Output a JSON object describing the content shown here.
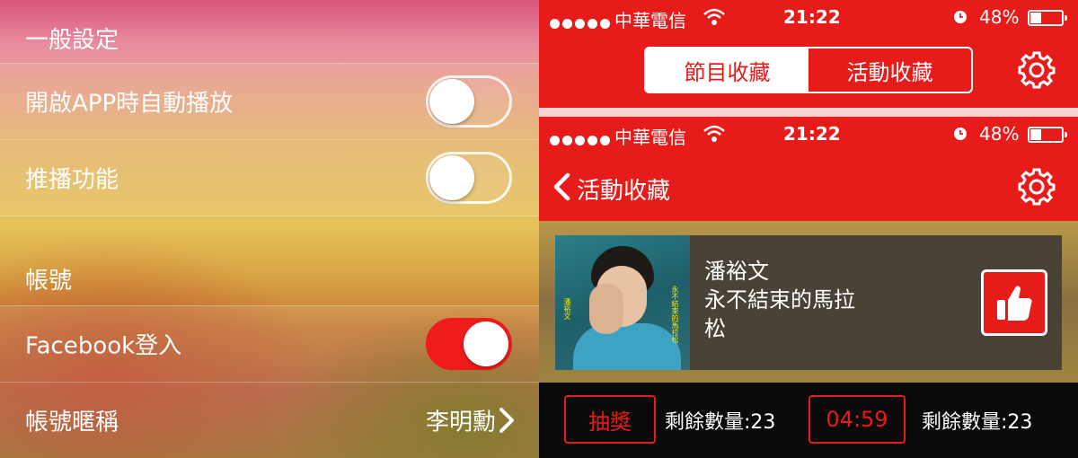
{
  "settings": {
    "general_header": "一般設定",
    "autoplay": {
      "label": "開啟APP時自動播放",
      "on": false
    },
    "push": {
      "label": "推播功能",
      "on": false
    },
    "account_header": "帳號",
    "facebook": {
      "label": "Facebook登入",
      "on": true
    },
    "nickname": {
      "label": "帳號暱稱",
      "value": "李明勳"
    }
  },
  "status_bar": {
    "carrier": "中華電信",
    "time": "21:22",
    "battery": "48%"
  },
  "top_screen": {
    "tabs": [
      {
        "label": "節目收藏",
        "active": true
      },
      {
        "label": "活動收藏",
        "active": false
      }
    ]
  },
  "bottom_screen": {
    "nav_title": "活動收藏",
    "card": {
      "artist": "潘裕文",
      "title_line1": "永不結束的馬拉",
      "title_line2": "松"
    },
    "lottery_label": "抽獎",
    "remaining_1": "剩餘數量:23",
    "countdown": "04:59",
    "remaining_2": "剩餘數量:23"
  },
  "colors": {
    "brand_red": "#e81b1b",
    "toggle_on": "#f01c1c"
  }
}
